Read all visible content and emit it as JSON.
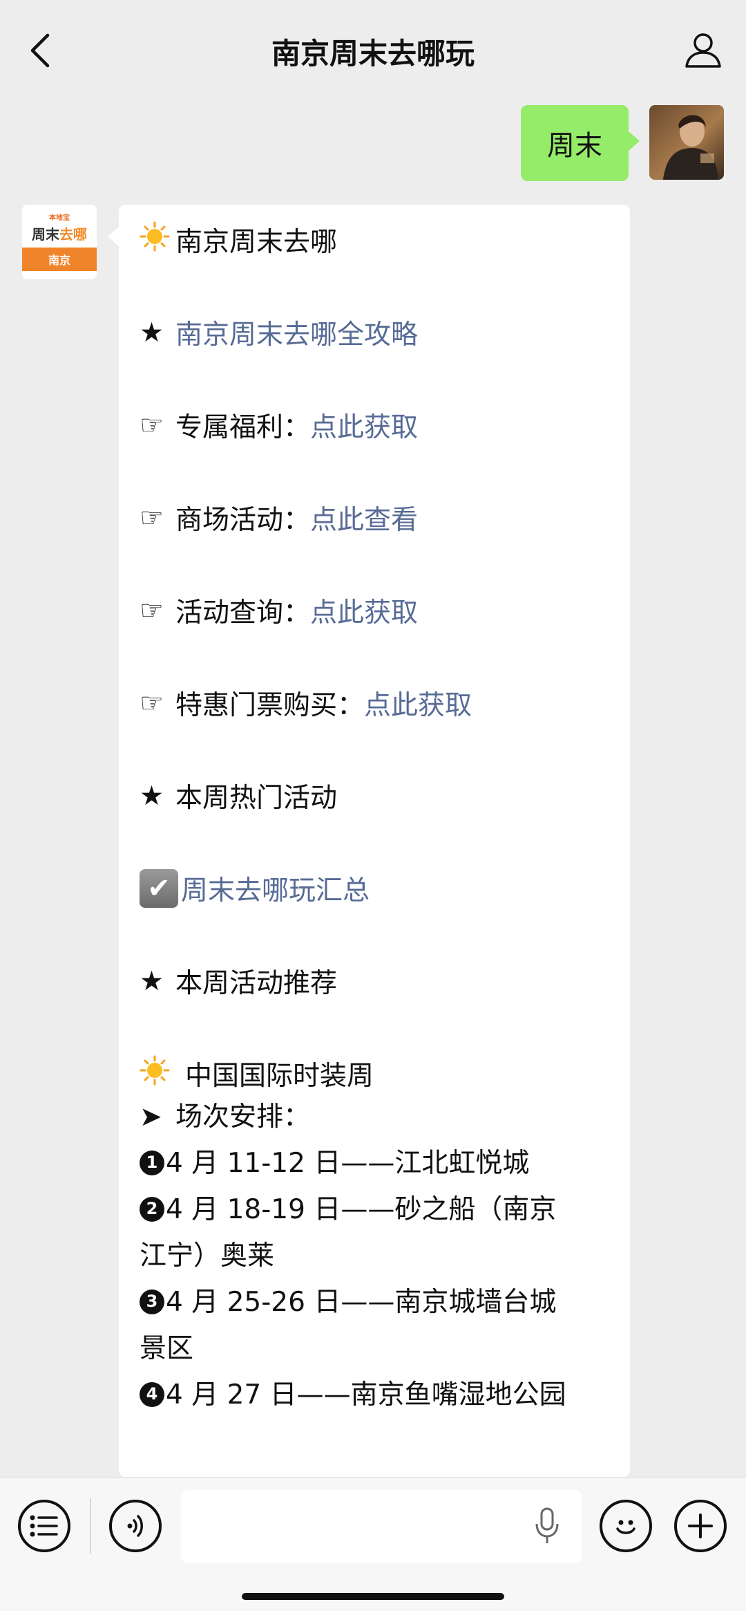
{
  "header": {
    "title": "南京周末去哪玩"
  },
  "user_message": {
    "text": "周末"
  },
  "bot_avatar": {
    "top_mark": "本地宝",
    "logo_main_a": "周末",
    "logo_main_b": "去哪",
    "logo_city": "南京"
  },
  "bot_message": {
    "heading": "南京周末去哪",
    "guide_link": "南京周末去哪全攻略",
    "items": [
      {
        "label": "专属福利：",
        "link": "点此获取"
      },
      {
        "label": "商场活动：",
        "link": "点此查看"
      },
      {
        "label": "活动查询：",
        "link": "点此获取"
      },
      {
        "label": "特惠门票购买：",
        "link": "点此获取"
      }
    ],
    "hot_title": "本周热门活动",
    "summary_link": "周末去哪玩汇总",
    "recommend_title": "本周活动推荐",
    "event_title": "中国国际时装周",
    "schedule_label": "场次安排：",
    "schedule_rows": [
      "4 月 11-12 日——江北虹悦城",
      "4 月 18-19 日——砂之船（南京",
      "江宁）奥莱",
      "4 月 25-26 日——南京城墙台城",
      "景区",
      "4 月 27 日——南京鱼嘴湿地公园"
    ],
    "schedule_numbers": [
      "1",
      "2",
      "3",
      "4"
    ]
  },
  "icons": {
    "sun": "sun-icon",
    "star": "★",
    "pointer": "☞",
    "arrow": "➤",
    "check": "✔"
  },
  "colors": {
    "link": "#576b95",
    "user_bubble": "#95ec69",
    "background": "#ededed"
  }
}
